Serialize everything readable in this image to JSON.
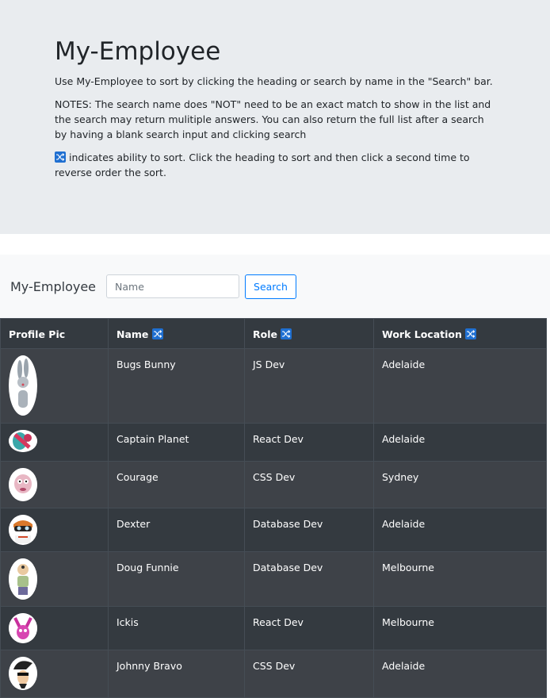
{
  "header": {
    "title": "My-Employee",
    "intro": "Use My-Employee to sort by clicking the heading or search by name in the \"Search\" bar.",
    "notes": "NOTES: The search name does \"NOT\" need to be an exact match to show in the list and the search may return mulitiple answers. You can also return the full list after a search by having a blank search input and clicking search",
    "sort_hint": " indicates ability to sort. Click the heading to sort and then click a second time to reverse order the sort."
  },
  "navbar": {
    "brand": "My-Employee",
    "search_placeholder": "Name",
    "search_button": "Search"
  },
  "table": {
    "columns": [
      "Profile Pic",
      "Name",
      "Role",
      "Work Location"
    ],
    "rows": [
      {
        "name": "Bugs Bunny",
        "role": "JS Dev",
        "location": "Adelaide"
      },
      {
        "name": "Captain Planet",
        "role": "React Dev",
        "location": "Adelaide"
      },
      {
        "name": "Courage",
        "role": "CSS Dev",
        "location": "Sydney"
      },
      {
        "name": "Dexter",
        "role": "Database Dev",
        "location": "Adelaide"
      },
      {
        "name": "Doug Funnie",
        "role": "Database Dev",
        "location": "Melbourne"
      },
      {
        "name": "Ickis",
        "role": "React Dev",
        "location": "Melbourne"
      },
      {
        "name": "Johnny Bravo",
        "role": "CSS Dev",
        "location": "Adelaide"
      }
    ]
  },
  "colors": {
    "accent": "#007bff",
    "sort_icon": "#1f6fd1",
    "table_bg": "#343a40"
  },
  "icons": {
    "sort": "shuffle-icon"
  }
}
